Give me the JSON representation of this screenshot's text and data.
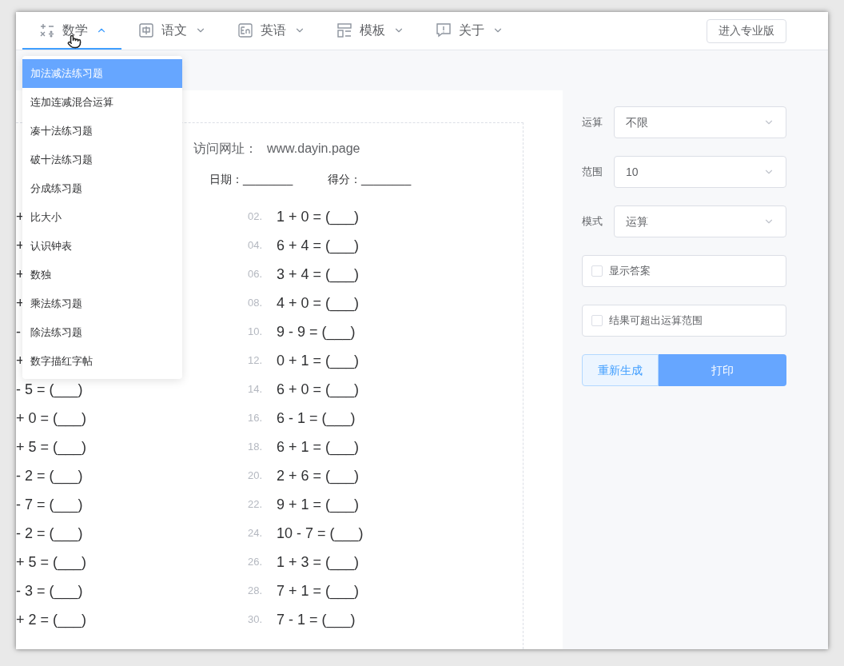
{
  "nav": {
    "items": [
      {
        "label": "数学",
        "selected": true,
        "expanded": true
      },
      {
        "label": "语文",
        "selected": false,
        "expanded": false
      },
      {
        "label": "英语",
        "selected": false,
        "expanded": false
      },
      {
        "label": "模板",
        "selected": false,
        "expanded": false
      },
      {
        "label": "关于",
        "selected": false,
        "expanded": false
      }
    ],
    "pro_button": "进入专业版"
  },
  "dropdown": {
    "items": [
      {
        "label": "加法减法练习题",
        "selected": true
      },
      {
        "label": "连加连减混合运算",
        "selected": false
      },
      {
        "label": "凑十法练习题",
        "selected": false
      },
      {
        "label": "破十法练习题",
        "selected": false
      },
      {
        "label": "分成练习题",
        "selected": false
      },
      {
        "label": "比大小",
        "selected": false
      },
      {
        "label": "认识钟表",
        "selected": false
      },
      {
        "label": "数独",
        "selected": false
      },
      {
        "label": "乘法练习题",
        "selected": false
      },
      {
        "label": "除法练习题",
        "selected": false
      },
      {
        "label": "数字描红字帖",
        "selected": false
      }
    ]
  },
  "worksheet": {
    "notice": "访问网址：",
    "url": "www.dayin.page",
    "date_label": "日期：",
    "date_blank": "________",
    "score_label": "得分：",
    "score_blank": "________",
    "left_column": [
      "+",
      "+",
      "+",
      "+",
      "-",
      "+",
      "- 5 = (___)",
      "+ 0 = (___)",
      "+ 5 = (___)",
      "- 2 = (___)",
      "- 7 = (___)",
      "- 2 = (___)",
      "+ 5 = (___)",
      "- 3 = (___)",
      "+ 2 = (___)"
    ],
    "right_column": [
      {
        "number": "02.",
        "expression": "1 + 0 = (___)"
      },
      {
        "number": "04.",
        "expression": "6 + 4 = (___)"
      },
      {
        "number": "06.",
        "expression": "3 + 4 = (___)"
      },
      {
        "number": "08.",
        "expression": "4 + 0 = (___)"
      },
      {
        "number": "10.",
        "expression": "9 - 9 = (___)"
      },
      {
        "number": "12.",
        "expression": "0 + 1 = (___)"
      },
      {
        "number": "14.",
        "expression": "6 + 0 = (___)"
      },
      {
        "number": "16.",
        "expression": "6 - 1 = (___)"
      },
      {
        "number": "18.",
        "expression": "6 + 1 = (___)"
      },
      {
        "number": "20.",
        "expression": "2 + 6 = (___)"
      },
      {
        "number": "22.",
        "expression": "9 + 1 = (___)"
      },
      {
        "number": "24.",
        "expression": "10 - 7 = (___)"
      },
      {
        "number": "26.",
        "expression": "1 + 3 = (___)"
      },
      {
        "number": "28.",
        "expression": "7 + 1 = (___)"
      },
      {
        "number": "30.",
        "expression": "7 - 1 = (___)"
      }
    ]
  },
  "settings": {
    "selects": [
      {
        "label": "运算",
        "value": "不限"
      },
      {
        "label": "范围",
        "value": "10"
      },
      {
        "label": "模式",
        "value": "运算"
      }
    ],
    "checkboxes": [
      {
        "label": "显示答案",
        "checked": false
      },
      {
        "label": "结果可超出运算范围",
        "checked": false
      }
    ],
    "buttons": [
      {
        "label": "重新生成",
        "kind": "secondary"
      },
      {
        "label": "打印",
        "kind": "primary"
      }
    ]
  }
}
